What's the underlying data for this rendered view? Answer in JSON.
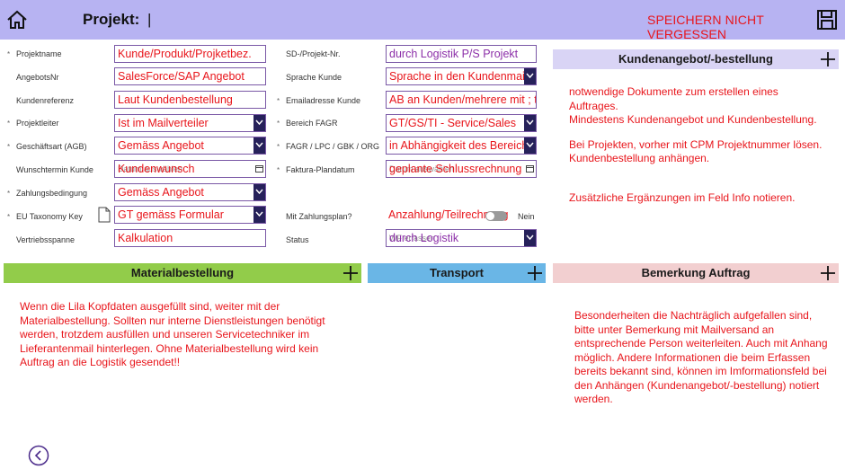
{
  "header": {
    "title": "Projekt:",
    "project_value": "|",
    "save_reminder": "SPEICHERN NICHT VERGESSEN",
    "background": "#b7b3f2"
  },
  "form": {
    "projektname": {
      "label": "Projektname",
      "value": "Kunde/Produkt/Projketbez."
    },
    "angebotsnr": {
      "label": "AngebotsNr",
      "value": "SalesForce/SAP Angebot"
    },
    "kundenreferenz": {
      "label": "Kundenreferenz",
      "value": "Laut Kundenbestellung"
    },
    "projektleiter": {
      "label": "Projektleiter",
      "value": "Ist im Mailverteiler"
    },
    "geschaeftsart": {
      "label": "Geschäftsart (AGB)",
      "value": "Gemäss Angebot"
    },
    "wunschtermin": {
      "label": "Wunschtermin Kunde",
      "value": "Kundenwunsch",
      "placeholder": "Datum auswählen"
    },
    "zahlungsbedingung": {
      "label": "Zahlungsbedingung",
      "value": "Gemäss Angebot"
    },
    "eu_taxonomy": {
      "label": "EU Taxonomy Key",
      "value": "GT gemäss Formular"
    },
    "vertriebsspanne": {
      "label": "Vertriebsspanne",
      "value": "Kalkulation"
    },
    "sd_projekt_nr": {
      "label": "SD-/Projekt-Nr.",
      "value": "durch Logistik  P/S Projekt"
    },
    "sprache_kunde": {
      "label": "Sprache Kunde",
      "value": "Sprache in den Kundenmails"
    },
    "emailadresse": {
      "label": "Emailadresse Kunde",
      "value": "AB an Kunden/mehrere mit ; trennen"
    },
    "bereich_fagr": {
      "label": "Bereich FAGR",
      "value": "GT/GS/TI - Service/Sales"
    },
    "fagr_lpc": {
      "label": "FAGR / LPC / GBK / ORG",
      "value": "in Abhängigkeit des Bereichs"
    },
    "faktura_plandatum": {
      "label": "Faktura-Plandatum",
      "value": "geplante Schlussrechnung",
      "placeholder": "Datum auswählen"
    },
    "mit_zahlungsplan": {
      "label": "Mit Zahlungsplan?",
      "value": "Anzahlung/Teilrechnung",
      "toggle_state": "Nein"
    },
    "status": {
      "label": "Status",
      "value": "durch Logistik",
      "ghost": "WF erfassen"
    }
  },
  "kundenangebot": {
    "title": "Kundenangebot/-bestellung",
    "bar_color": "#d9d4f5",
    "lines": [
      "notwendige Dokumente zum erstellen eines",
      "Auftrages.",
      "Mindestens Kundenangebot und Kundenbestellung.",
      "",
      "Bei Projekten, vorher mit CPM Projektnummer lösen.",
      "Kundenbestellung anhängen.",
      "",
      "",
      "Zusätzliche Ergänzungen im Feld Info notieren."
    ]
  },
  "materialbestellung": {
    "title": "Materialbestellung",
    "bar_color": "#92cc4a",
    "lines": [
      "Wenn die Lila Kopfdaten ausgefüllt sind, weiter mit der",
      "Materialbestellung. Sollten nur interne Dienstleistungen benötigt",
      "werden, trotzdem ausfüllen und unseren Servicetechniker im",
      "Lieferantenmail hinterlegen. Ohne Materialbestellung wird kein",
      "Auftrag an die Logistik gesendet!!"
    ]
  },
  "transport": {
    "title": "Transport",
    "bar_color": "#6ab6e6"
  },
  "bemerkung": {
    "title": "Bemerkung Auftrag",
    "bar_color": "#f2cfd0",
    "lines": [
      "Besonderheiten die Nachträglich aufgefallen sind,",
      "bitte unter Bemerkung mit Mailversand an",
      "entsprechende Person weiterleiten. Auch mit Anhang",
      "möglich. Andere Informationen die beim Erfassen",
      "bereits bekannt sind, können im Imformationsfeld bei",
      "den Anhängen (Kundenangebot/-bestellung) notiert",
      "werden."
    ]
  }
}
